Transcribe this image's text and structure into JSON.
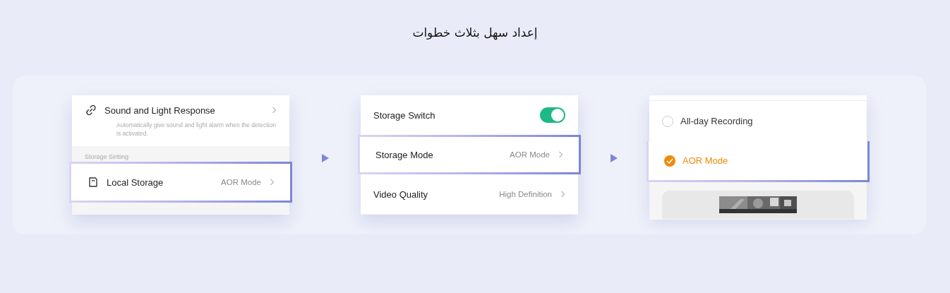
{
  "title": "إعداد سهل بثلاث خطوات",
  "steps": [
    {
      "rows": [
        {
          "kind": "setting",
          "label": "Sound and Light Response",
          "description": "Automatically give sound and light alarm when the detection is activated.",
          "highlighted": false
        },
        {
          "kind": "section",
          "label": "Storage Setting"
        },
        {
          "kind": "setting",
          "label": "Local Storage",
          "value": "AOR Mode",
          "highlighted": true
        }
      ]
    },
    {
      "rows": [
        {
          "kind": "toggle",
          "label": "Storage Switch",
          "on": true,
          "highlighted": false
        },
        {
          "kind": "setting",
          "label": "Storage Mode",
          "value": "AOR Mode",
          "highlighted": true
        },
        {
          "kind": "setting",
          "label": "Video Quality",
          "value": "High Definition",
          "highlighted": false
        }
      ]
    },
    {
      "rows": [
        {
          "kind": "radio",
          "label": "All-day Recording",
          "selected": false,
          "highlighted": false
        },
        {
          "kind": "radio",
          "label": "AOR Mode",
          "selected": true,
          "highlighted": true
        },
        {
          "kind": "preview"
        }
      ]
    }
  ]
}
